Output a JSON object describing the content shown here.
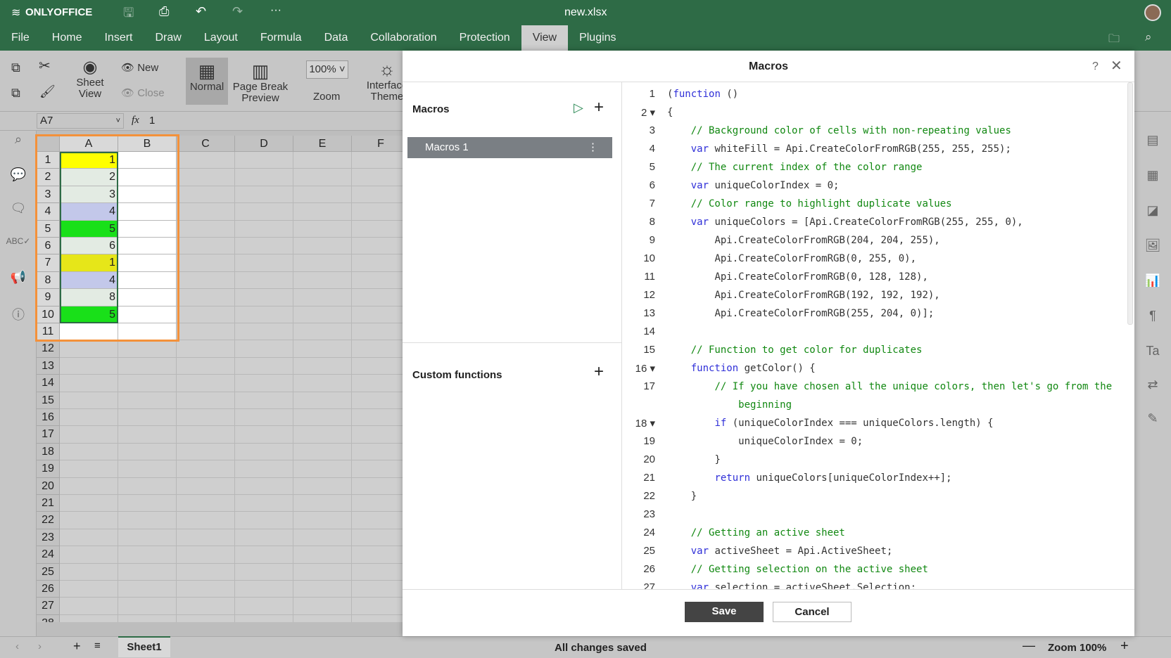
{
  "app": {
    "brand": "ONLYOFFICE",
    "title": "new.xlsx"
  },
  "menu": [
    "File",
    "Home",
    "Insert",
    "Draw",
    "Layout",
    "Formula",
    "Data",
    "Collaboration",
    "Protection",
    "View",
    "Plugins"
  ],
  "menu_active": "View",
  "toolbar": {
    "sheet_view": "Sheet View",
    "new": "New",
    "close": "Close",
    "normal": "Normal",
    "page_break": "Page Break Preview",
    "zoom_value": "100%",
    "zoom": "Zoom",
    "interface_theme": "Interface Theme"
  },
  "formula": {
    "cell_ref": "A7",
    "fx": "fx",
    "value": "1"
  },
  "grid": {
    "columns": [
      "A",
      "B",
      "C",
      "D",
      "E",
      "F"
    ],
    "rows": [
      "1",
      "2",
      "3",
      "4",
      "5",
      "6",
      "7",
      "8",
      "9",
      "10",
      "11",
      "12",
      "13",
      "14",
      "15",
      "16",
      "17",
      "18",
      "19",
      "20",
      "21",
      "22",
      "23",
      "24",
      "25",
      "26",
      "27",
      "28"
    ],
    "a_values": [
      "1",
      "2",
      "3",
      "4",
      "5",
      "6",
      "1",
      "4",
      "8",
      "5"
    ],
    "a_fills": [
      "#ffff00",
      "#e3ebe3",
      "#e3ebe3",
      "#c3c8ea",
      "#19e019",
      "#e3ebe3",
      "#e6e619",
      "#c3c8ea",
      "#e3ebe3",
      "#19e019"
    ]
  },
  "dialog": {
    "title": "Macros",
    "help": "?",
    "macros_label": "Macros",
    "macro_items": [
      "Macros 1"
    ],
    "custom_functions_label": "Custom functions",
    "save": "Save",
    "cancel": "Cancel"
  },
  "code": [
    "(function ()",
    "{",
    "    // Background color of cells with non-repeating values",
    "    var whiteFill = Api.CreateColorFromRGB(255, 255, 255);",
    "    // The current index of the color range",
    "    var uniqueColorIndex = 0;",
    "    // Color range to highlight duplicate values",
    "    var uniqueColors = [Api.CreateColorFromRGB(255, 255, 0),",
    "        Api.CreateColorFromRGB(204, 204, 255),",
    "        Api.CreateColorFromRGB(0, 255, 0),",
    "        Api.CreateColorFromRGB(0, 128, 128),",
    "        Api.CreateColorFromRGB(192, 192, 192),",
    "        Api.CreateColorFromRGB(255, 204, 0)];",
    "",
    "    // Function to get color for duplicates",
    "    function getColor() {",
    "        // If you have chosen all the unique colors, then let's go from the\n            beginning",
    "        if (uniqueColorIndex === uniqueColors.length) {",
    "            uniqueColorIndex = 0;",
    "        }",
    "        return uniqueColors[uniqueColorIndex++];",
    "    }",
    "",
    "    // Getting an active sheet",
    "    var activeSheet = Api.ActiveSheet;",
    "    // Getting selection on the active sheet",
    "    var selection = activeSheet.Selection;"
  ],
  "status": {
    "sheet": "Sheet1",
    "saved": "All changes saved",
    "zoom": "Zoom 100%"
  }
}
